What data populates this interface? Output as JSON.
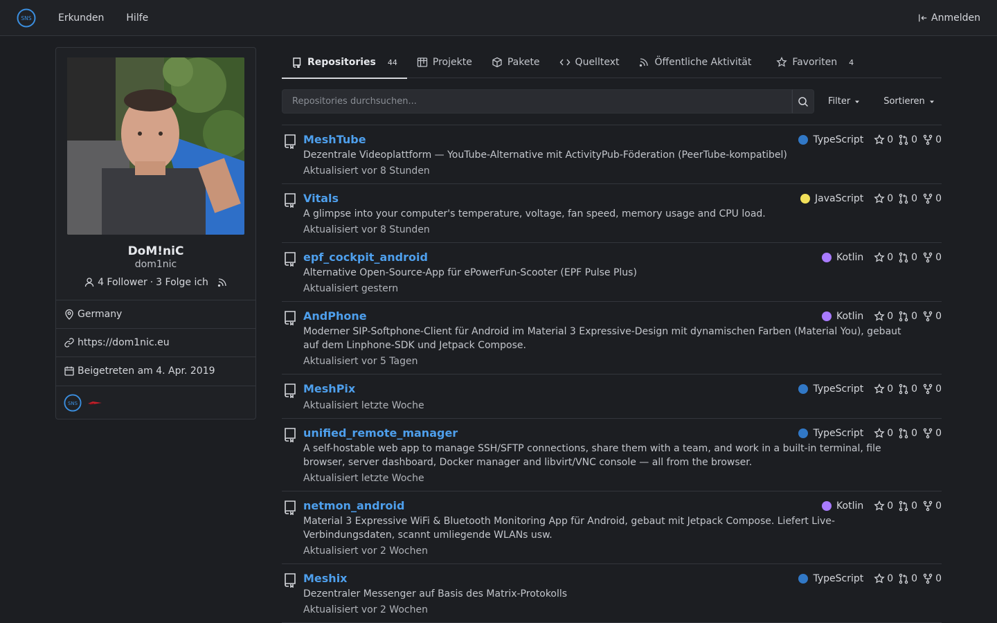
{
  "navbar": {
    "logo_text": "SNS",
    "items": [
      {
        "label": "Erkunden"
      },
      {
        "label": "Hilfe"
      }
    ],
    "signin_label": "Anmelden"
  },
  "profile": {
    "full_name": "DoM!niC",
    "username": "dom1nic",
    "followers": "4 Follower",
    "separator": "·",
    "following": "3 Folge ich",
    "location": "Germany",
    "website": "https://dom1nic.eu",
    "joined": "Beigetreten am 4. Apr. 2019"
  },
  "tabs": [
    {
      "label": "Repositories",
      "count": "44",
      "icon": "repo-icon"
    },
    {
      "label": "Projekte",
      "count": "",
      "icon": "project-icon"
    },
    {
      "label": "Pakete",
      "count": "",
      "icon": "package-icon"
    },
    {
      "label": "Quelltext",
      "count": "",
      "icon": "code-icon"
    },
    {
      "label": "Öffentliche Aktivität",
      "count": "",
      "icon": "rss-icon"
    },
    {
      "label": "Favoriten",
      "count": "4",
      "icon": "star-icon"
    }
  ],
  "search": {
    "placeholder": "Repositories durchsuchen...",
    "filter_label": "Filter",
    "sort_label": "Sortieren"
  },
  "colors": {
    "TypeScript": "#3178c6",
    "JavaScript": "#f1e05a",
    "Kotlin": "#a97bff",
    "link": "#4e9fec"
  },
  "repos": [
    {
      "name": "MeshTube",
      "desc": "Dezentrale Videoplattform — YouTube-Alternative mit ActivityPub-Föderation (PeerTube-kompatibel)",
      "updated": "Aktualisiert vor 8 Stunden",
      "lang": "TypeScript",
      "stars": "0",
      "prs": "0",
      "forks": "0"
    },
    {
      "name": "Vitals",
      "desc": "A glimpse into your computer's temperature, voltage, fan speed, memory usage and CPU load.",
      "updated": "Aktualisiert vor 8 Stunden",
      "lang": "JavaScript",
      "stars": "0",
      "prs": "0",
      "forks": "0"
    },
    {
      "name": "epf_cockpit_android",
      "desc": "Alternative Open-Source-App für ePowerFun-Scooter (EPF Pulse Plus)",
      "updated": "Aktualisiert gestern",
      "lang": "Kotlin",
      "stars": "0",
      "prs": "0",
      "forks": "0"
    },
    {
      "name": "AndPhone",
      "desc": "Moderner SIP-Softphone-Client für Android im Material 3 Expressive-Design mit dynamischen Farben (Material You), gebaut auf dem Linphone-SDK und Jetpack Compose.",
      "updated": "Aktualisiert vor 5 Tagen",
      "lang": "Kotlin",
      "stars": "0",
      "prs": "0",
      "forks": "0"
    },
    {
      "name": "MeshPix",
      "desc": "",
      "updated": "Aktualisiert letzte Woche",
      "lang": "TypeScript",
      "stars": "0",
      "prs": "0",
      "forks": "0"
    },
    {
      "name": "unified_remote_manager",
      "desc": "A self-hostable web app to manage SSH/SFTP connections, share them with a team, and work in a built-in terminal, file browser, server dashboard, Docker manager and libvirt/VNC console — all from the browser.",
      "updated": "Aktualisiert letzte Woche",
      "lang": "TypeScript",
      "stars": "0",
      "prs": "0",
      "forks": "0"
    },
    {
      "name": "netmon_android",
      "desc": "Material 3 Expressive WiFi & Bluetooth Monitoring App für Android, gebaut mit Jetpack Compose. Liefert Live-Verbindungsdaten, scannt umliegende WLANs usw.",
      "updated": "Aktualisiert vor 2 Wochen",
      "lang": "Kotlin",
      "stars": "0",
      "prs": "0",
      "forks": "0"
    },
    {
      "name": "Meshix",
      "desc": "Dezentraler Messenger auf Basis des Matrix-Protokolls",
      "updated": "Aktualisiert vor 2 Wochen",
      "lang": "TypeScript",
      "stars": "0",
      "prs": "0",
      "forks": "0"
    }
  ]
}
